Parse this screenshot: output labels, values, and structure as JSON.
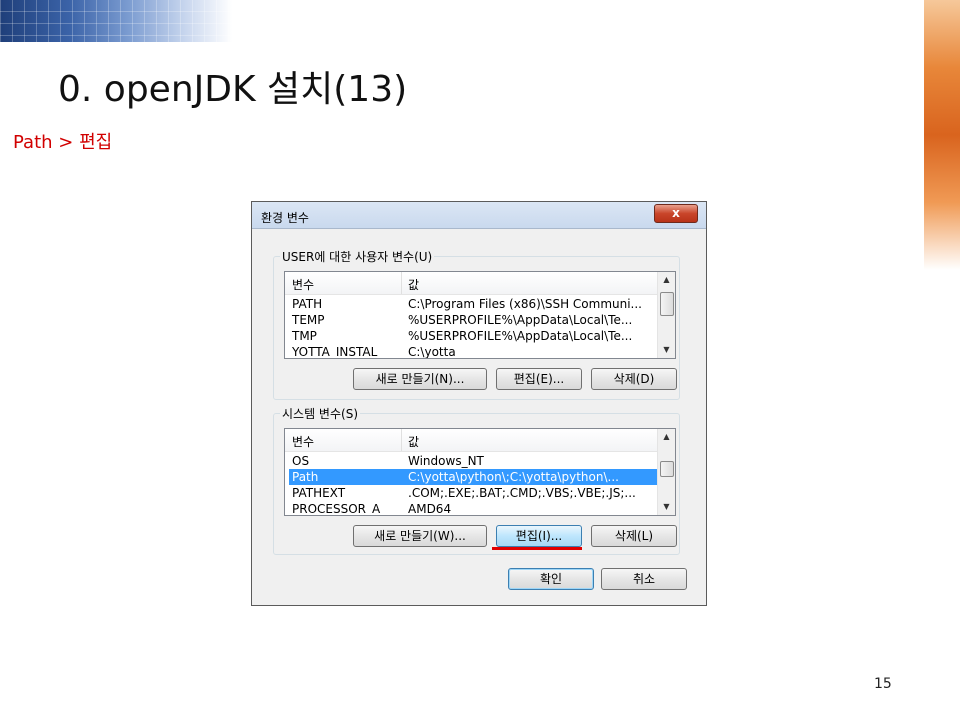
{
  "slide": {
    "title": "0. openJDK 설치(13)",
    "subtitle": "Path  >  편집",
    "page_number": "15"
  },
  "dialog": {
    "title": "환경 변수",
    "close_label": "x",
    "user_group": {
      "label": "USER에 대한 사용자 변수(U)",
      "columns": [
        "변수",
        "값"
      ],
      "rows": [
        {
          "name": "PATH",
          "value": "C:\\Program Files (x86)\\SSH Communi..."
        },
        {
          "name": "TEMP",
          "value": "%USERPROFILE%\\AppData\\Local\\Te..."
        },
        {
          "name": "TMP",
          "value": "%USERPROFILE%\\AppData\\Local\\Te..."
        },
        {
          "name": "YOTTA_INSTAL",
          "value": "C:\\yotta"
        }
      ],
      "buttons": {
        "new": "새로 만들기(N)...",
        "edit": "편집(E)...",
        "delete": "삭제(D)"
      }
    },
    "system_group": {
      "label": "시스템 변수(S)",
      "columns": [
        "변수",
        "값"
      ],
      "rows": [
        {
          "name": "OS",
          "value": "Windows_NT"
        },
        {
          "name": "Path",
          "value": "C:\\yotta\\python\\;C:\\yotta\\python\\..."
        },
        {
          "name": "PATHEXT",
          "value": ".COM;.EXE;.BAT;.CMD;.VBS;.VBE;.JS;..."
        },
        {
          "name": "PROCESSOR_A",
          "value": "AMD64"
        }
      ],
      "selected_row": "Path",
      "buttons": {
        "new": "새로 만들기(W)...",
        "edit": "편집(I)...",
        "delete": "삭제(L)"
      }
    },
    "ok_label": "확인",
    "cancel_label": "취소"
  },
  "colors": {
    "highlight": "#e00000",
    "selection": "#3399ff",
    "title_red": "#d10000"
  },
  "icons": {
    "scroll_up": "▲",
    "scroll_down": "▼"
  }
}
